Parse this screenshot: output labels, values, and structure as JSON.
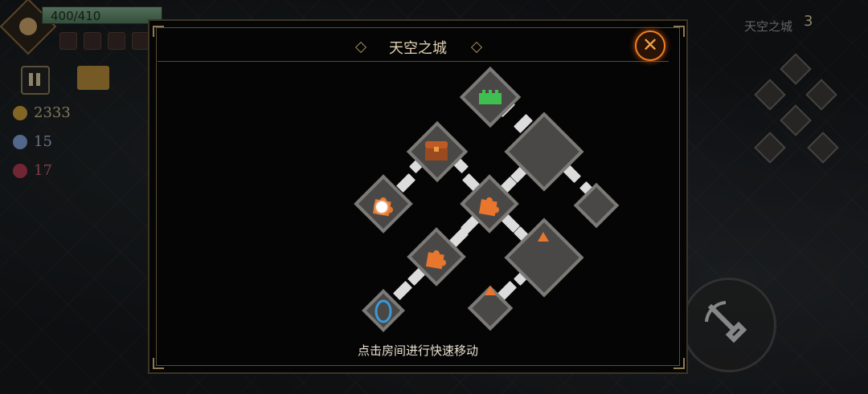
{
  "hud": {
    "hp_text": "400/410",
    "gold": "2333",
    "souls": "15",
    "gems": "17",
    "level_name": "天空之城",
    "level_number": "3"
  },
  "map_panel": {
    "title": "天空之城",
    "hint": "点击房间进行快速移动",
    "close_icon": "crossed-swords-close-icon"
  },
  "rooms": [
    {
      "name": "castle-room",
      "icon": "castle-icon"
    },
    {
      "name": "shop-room",
      "icon": "chest-icon"
    },
    {
      "name": "large-room-top",
      "icon": ""
    },
    {
      "name": "current-room",
      "icon": "puzzle-icon",
      "player": true
    },
    {
      "name": "puzzle-room-center",
      "icon": "puzzle-icon"
    },
    {
      "name": "side-room-right",
      "icon": ""
    },
    {
      "name": "puzzle-room-lower",
      "icon": "puzzle-icon"
    },
    {
      "name": "large-room-bottom",
      "icon": "triangle-marker-icon"
    },
    {
      "name": "portal-room",
      "icon": "portal-icon"
    },
    {
      "name": "marker-room",
      "icon": "triangle-marker-icon"
    }
  ],
  "colors": {
    "accent_orange": "#e8762e",
    "room_fill": "#4a4846",
    "portal_blue": "#3a9ad8",
    "castle_green": "#3fbf4f"
  }
}
